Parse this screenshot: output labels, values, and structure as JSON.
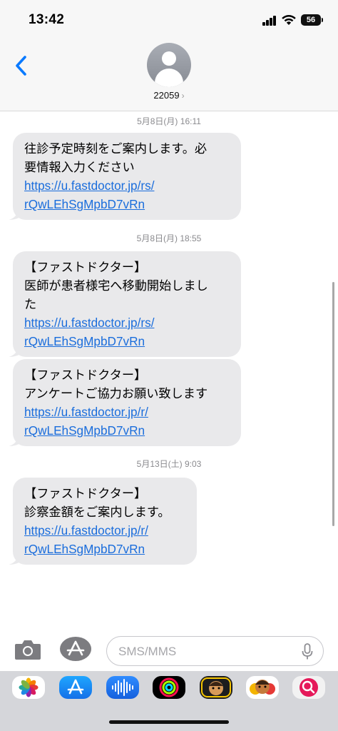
{
  "status_bar": {
    "time": "13:42",
    "battery_level": "56"
  },
  "header": {
    "contact_name": "22059",
    "chevron": "›"
  },
  "messages": [
    {
      "timestamp_date": "5月8日(月)",
      "timestamp_time": "16:11",
      "lines": [
        "往診予定時刻をご案内します。必",
        "要情報入力ください"
      ],
      "link_lines": [
        " https://u.fastdoctor.jp/rs/",
        "rQwLEhSgMpbD7vRn"
      ]
    },
    {
      "timestamp_date": "5月8日(月)",
      "timestamp_time": "18:55",
      "lines": [
        "【ファストドクター】",
        "医師が患者様宅へ移動開始しまし",
        "た"
      ],
      "link_lines": [
        "https://u.fastdoctor.jp/rs/",
        "rQwLEhSgMpbD7vRn"
      ]
    },
    {
      "lines": [
        "【ファストドクター】",
        "アンケートご協力お願い致します"
      ],
      "link_lines": [
        "https://u.fastdoctor.jp/r/",
        "rQwLEhSgMpbD7vRn"
      ]
    },
    {
      "timestamp_date": "5月13日(土)",
      "timestamp_time": "9:03",
      "lines": [
        "【ファストドクター】",
        "診察金額をご案内します。"
      ],
      "link_lines": [
        "https://u.fastdoctor.jp/r/",
        "rQwLEhSgMpbD7vRn"
      ]
    }
  ],
  "input": {
    "placeholder": "SMS/MMS"
  },
  "icons": {
    "back": "chevron-left-icon",
    "camera": "camera-icon",
    "apps": "app-store-icon",
    "mic": "microphone-icon"
  },
  "app_drawer": {
    "apps": [
      "photos-icon",
      "app-store-icon",
      "audio-message-icon",
      "activity-icon",
      "memoji-icon",
      "animoji-icon",
      "web-search-icon"
    ]
  },
  "colors": {
    "link": "#1a6ddc",
    "back_accent": "#0a7aff",
    "bubble": "#e9e9eb"
  }
}
